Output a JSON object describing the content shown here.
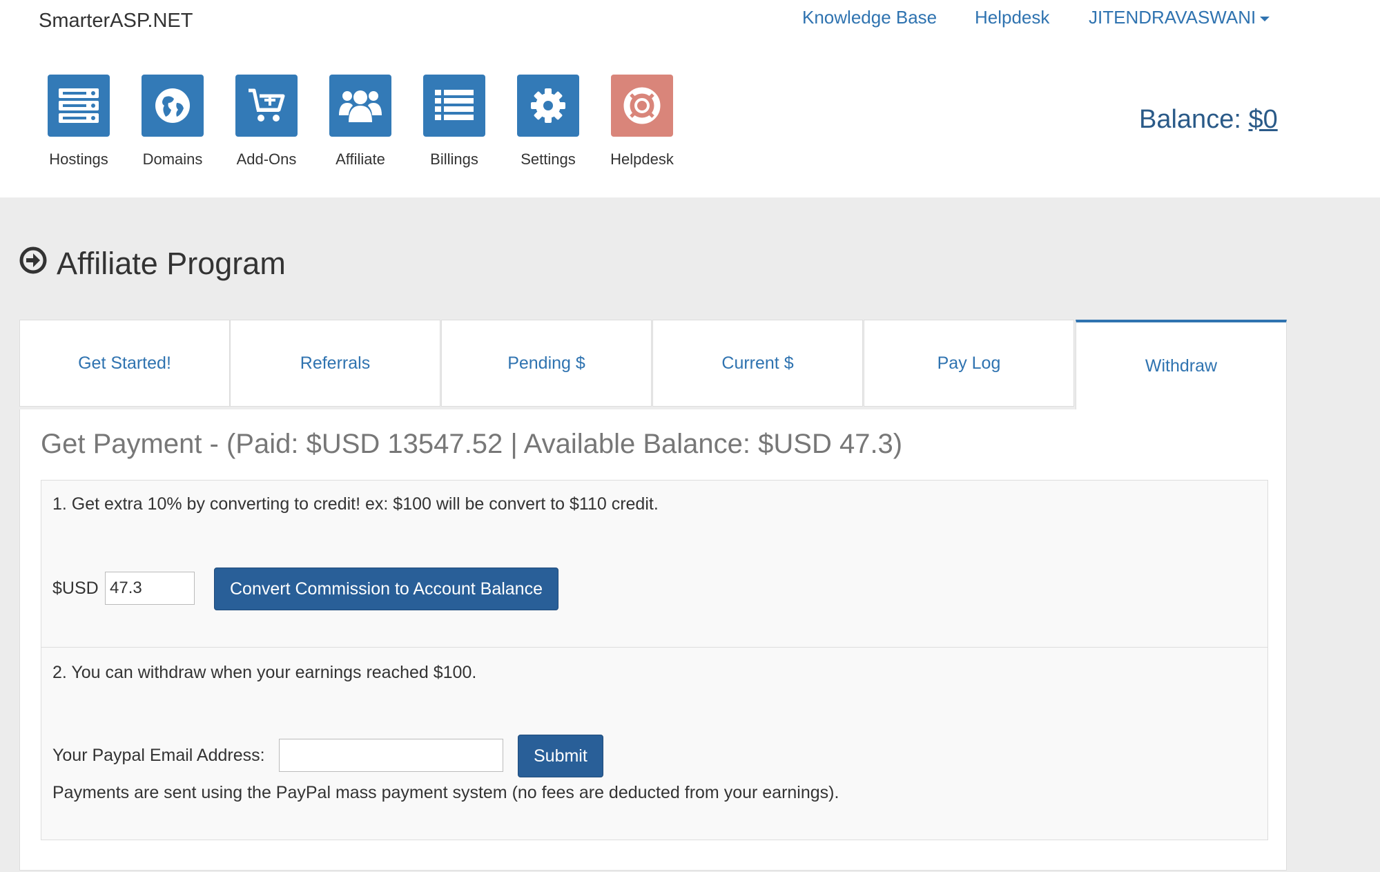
{
  "brand": "SmarterASP.NET",
  "topnav": {
    "knowledge_base": "Knowledge Base",
    "helpdesk": "Helpdesk",
    "user": "JITENDRAVASWANI"
  },
  "iconnav": [
    {
      "label": "Hostings",
      "icon": "server-icon"
    },
    {
      "label": "Domains",
      "icon": "globe-icon"
    },
    {
      "label": "Add-Ons",
      "icon": "cart-plus-icon"
    },
    {
      "label": "Affiliate",
      "icon": "users-icon"
    },
    {
      "label": "Billings",
      "icon": "list-icon"
    },
    {
      "label": "Settings",
      "icon": "gear-icon"
    },
    {
      "label": "Helpdesk",
      "icon": "lifebuoy-icon"
    }
  ],
  "balance": {
    "label": "Balance: ",
    "amount": "$0"
  },
  "page_title": "Affiliate Program",
  "tabs": [
    {
      "label": "Get Started!",
      "active": false
    },
    {
      "label": "Referrals",
      "active": false
    },
    {
      "label": "Pending $",
      "active": false
    },
    {
      "label": "Current $",
      "active": false
    },
    {
      "label": "Pay Log",
      "active": false
    },
    {
      "label": "Withdraw",
      "active": true
    }
  ],
  "withdraw": {
    "heading": "Get Payment - (Paid: $USD 13547.52 | Available Balance: $USD 47.3)",
    "convert": {
      "note": "1. Get extra 10% by converting to credit! ex: $100 will be convert to $110 credit.",
      "currency_label": "$USD",
      "amount_value": "47.3",
      "button": "Convert Commission to Account Balance"
    },
    "paypal": {
      "note": "2. You can withdraw when your earnings reached $100.",
      "email_label": "Your Paypal Email Address:",
      "email_value": "",
      "submit": "Submit",
      "footer": "Payments are sent using the PayPal mass payment system (no fees are deducted from your earnings)."
    }
  },
  "colors": {
    "accent": "#337ab7",
    "help": "#d9857a",
    "link": "#2f73b0"
  }
}
